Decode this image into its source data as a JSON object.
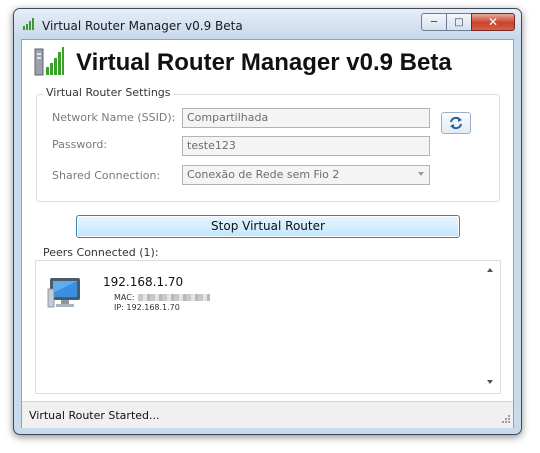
{
  "window": {
    "title": "Virtual Router Manager v0.9 Beta",
    "caption_buttons": {
      "minimize": "minimize-icon",
      "maximize": "maximize-icon",
      "close": "close-icon"
    }
  },
  "header": {
    "title": "Virtual Router Manager v0.9 Beta",
    "icon": "signal-bars-icon"
  },
  "settings": {
    "legend": "Virtual Router Settings",
    "ssid_label": "Network Name (SSID):",
    "ssid_value": "Compartilhada",
    "password_label": "Password:",
    "password_value": "teste123",
    "shared_label": "Shared Connection:",
    "shared_value": "Conexão de Rede sem Fio 2",
    "refresh_icon": "refresh-icon"
  },
  "actions": {
    "stop_label": "Stop Virtual Router"
  },
  "peers": {
    "label": "Peers Connected (1):",
    "items": [
      {
        "ip": "192.168.1.70",
        "mac_label": "MAC:",
        "ip_detail": "IP: 192.168.1.70",
        "icon": "computer-monitor-icon"
      }
    ]
  },
  "status": {
    "text": "Virtual Router Started..."
  },
  "colors": {
    "accent": "#3c7fb1",
    "button_fill": "#bee6fd",
    "close_red": "#c7432b",
    "frame": "#c9daec"
  }
}
